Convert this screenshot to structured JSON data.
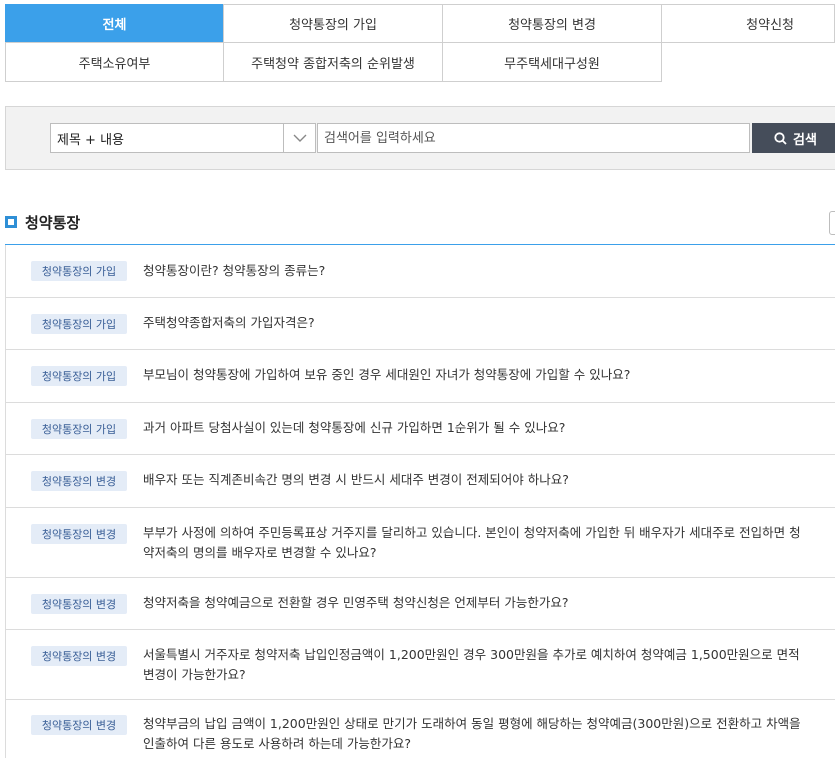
{
  "tabs": [
    {
      "label": "전체",
      "active": true
    },
    {
      "label": "청약통장의 가입"
    },
    {
      "label": "청약통장의 변경"
    },
    {
      "label": "청약신청"
    },
    {
      "label": "주택소유여부"
    },
    {
      "label": "주택청약 종합저축의 순위발생"
    },
    {
      "label": "무주택세대구성원"
    }
  ],
  "search": {
    "select_value": "제목 + 내용",
    "placeholder": "검색어를 입력하세요",
    "button_label": "검색"
  },
  "section": {
    "title": "청약통장"
  },
  "faq": [
    {
      "category": "청약통장의 가입",
      "question": "청약통장이란? 청약통장의 종류는?"
    },
    {
      "category": "청약통장의 가입",
      "question": "주택청약종합저축의 가입자격은?"
    },
    {
      "category": "청약통장의 가입",
      "question": "부모님이 청약통장에 가입하여 보유 중인 경우 세대원인 자녀가 청약통장에 가입할 수 있나요?"
    },
    {
      "category": "청약통장의 가입",
      "question": "과거 아파트 당첨사실이 있는데 청약통장에 신규 가입하면 1순위가 될 수 있나요?"
    },
    {
      "category": "청약통장의 변경",
      "question": "배우자 또는 직계존비속간 명의 변경 시 반드시 세대주 변경이 전제되어야 하나요?"
    },
    {
      "category": "청약통장의 변경",
      "question": "부부가 사정에 의하여 주민등록표상 거주지를 달리하고 있습니다. 본인이 청약저축에 가입한 뒤 배우자가 세대주로 전입하면 청약저축의 명의를 배우자로 변경할 수 있나요?"
    },
    {
      "category": "청약통장의 변경",
      "question": "청약저축을 청약예금으로 전환할 경우 민영주택 청약신청은 언제부터 가능한가요?"
    },
    {
      "category": "청약통장의 변경",
      "question": "서울특별시 거주자로 청약저축 납입인정금액이 1,200만원인 경우 300만원을 추가로 예치하여 청약예금 1,500만원으로 면적 변경이 가능한가요?"
    },
    {
      "category": "청약통장의 변경",
      "question": "청약부금의 납입 금액이 1,200만원인 상태로 만기가 도래하여 동일 평형에 해당하는 청약예금(300만원)으로 전환하고 차액을 인출하여 다른 용도로 사용하려 하는데 가능한가요?"
    }
  ]
}
